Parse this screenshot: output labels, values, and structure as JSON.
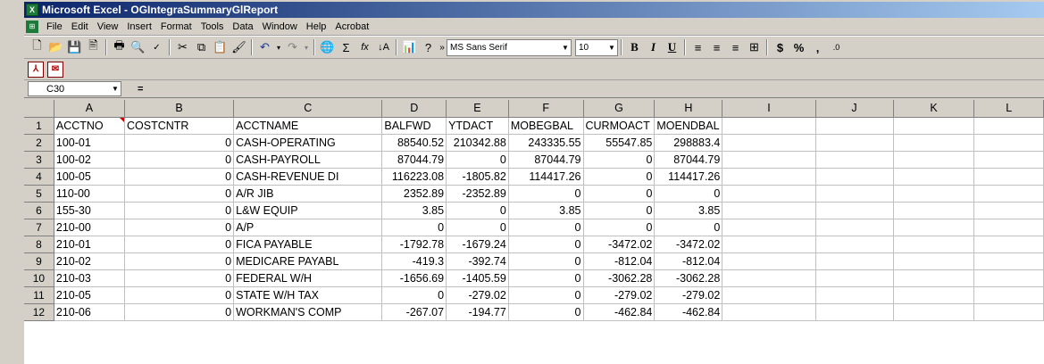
{
  "window": {
    "title": "Microsoft Excel - OGIntegraSummaryGlReport",
    "app_icon": "excel-icon"
  },
  "menus": [
    {
      "label": "File"
    },
    {
      "label": "Edit"
    },
    {
      "label": "View"
    },
    {
      "label": "Insert"
    },
    {
      "label": "Format"
    },
    {
      "label": "Tools"
    },
    {
      "label": "Data"
    },
    {
      "label": "Window"
    },
    {
      "label": "Help"
    },
    {
      "label": "Acrobat"
    }
  ],
  "toolbar": {
    "font": "MS Sans Serif",
    "size": "10",
    "chevron": "»"
  },
  "formula_bar": {
    "cell_ref": "C30",
    "equals": "="
  },
  "columns": [
    "A",
    "B",
    "C",
    "D",
    "E",
    "F",
    "G",
    "H",
    "I",
    "J",
    "K",
    "L"
  ],
  "rows": [
    {
      "n": "1",
      "cells": [
        "ACCTNO",
        "COSTCNTR",
        "ACCTNAME",
        "BALFWD",
        "YTDACT",
        "MOBEGBAL",
        "CURMOACT",
        "MOENDBAL",
        "",
        "",
        "",
        ""
      ]
    },
    {
      "n": "2",
      "cells": [
        "100-01",
        "0",
        "CASH-OPERATING",
        "88540.52",
        "210342.88",
        "243335.55",
        "55547.85",
        "298883.4",
        "",
        "",
        "",
        ""
      ]
    },
    {
      "n": "3",
      "cells": [
        "100-02",
        "0",
        "CASH-PAYROLL",
        "87044.79",
        "0",
        "87044.79",
        "0",
        "87044.79",
        "",
        "",
        "",
        ""
      ]
    },
    {
      "n": "4",
      "cells": [
        "100-05",
        "0",
        "CASH-REVENUE DI",
        "116223.08",
        "-1805.82",
        "114417.26",
        "0",
        "114417.26",
        "",
        "",
        "",
        ""
      ]
    },
    {
      "n": "5",
      "cells": [
        "110-00",
        "0",
        "A/R JIB",
        "2352.89",
        "-2352.89",
        "0",
        "0",
        "0",
        "",
        "",
        "",
        ""
      ]
    },
    {
      "n": "6",
      "cells": [
        "155-30",
        "0",
        "L&W EQUIP",
        "3.85",
        "0",
        "3.85",
        "0",
        "3.85",
        "",
        "",
        "",
        ""
      ]
    },
    {
      "n": "7",
      "cells": [
        "210-00",
        "0",
        "A/P",
        "0",
        "0",
        "0",
        "0",
        "0",
        "",
        "",
        "",
        ""
      ]
    },
    {
      "n": "8",
      "cells": [
        "210-01",
        "0",
        "FICA PAYABLE",
        "-1792.78",
        "-1679.24",
        "0",
        "-3472.02",
        "-3472.02",
        "",
        "",
        "",
        ""
      ]
    },
    {
      "n": "9",
      "cells": [
        "210-02",
        "0",
        "MEDICARE PAYABL",
        "-419.3",
        "-392.74",
        "0",
        "-812.04",
        "-812.04",
        "",
        "",
        "",
        ""
      ]
    },
    {
      "n": "10",
      "cells": [
        "210-03",
        "0",
        "FEDERAL W/H",
        "-1656.69",
        "-1405.59",
        "0",
        "-3062.28",
        "-3062.28",
        "",
        "",
        "",
        ""
      ]
    },
    {
      "n": "11",
      "cells": [
        "210-05",
        "0",
        "STATE W/H TAX",
        "0",
        "-279.02",
        "0",
        "-279.02",
        "-279.02",
        "",
        "",
        "",
        ""
      ]
    },
    {
      "n": "12",
      "cells": [
        "210-06",
        "0",
        "WORKMAN'S COMP",
        "-267.07",
        "-194.77",
        "0",
        "-462.84",
        "-462.84",
        "",
        "",
        "",
        ""
      ]
    }
  ]
}
